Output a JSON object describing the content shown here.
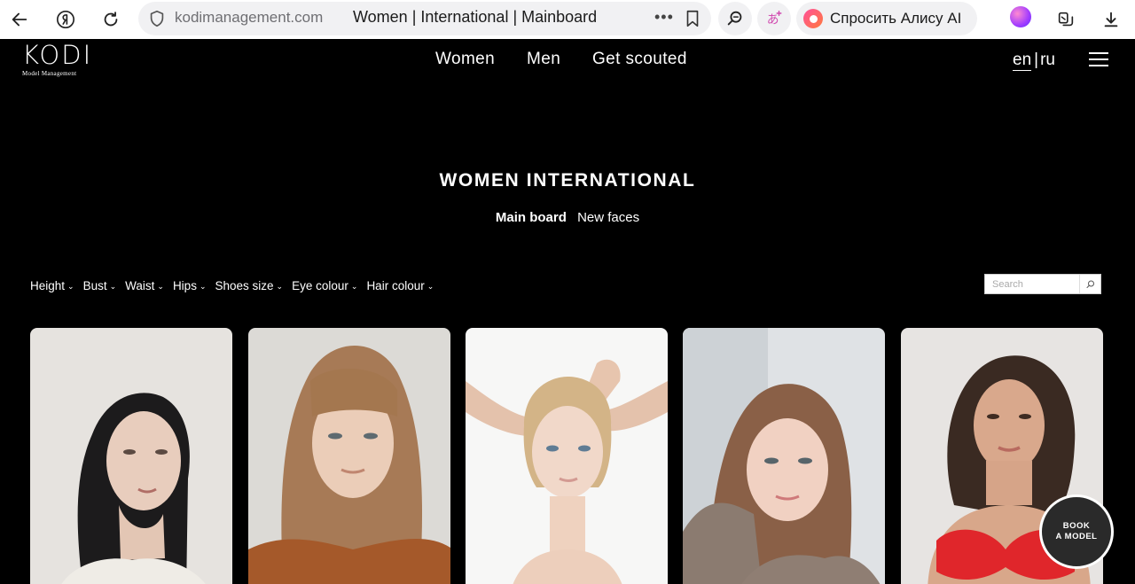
{
  "browser": {
    "domain": "kodimanagement.com",
    "page_title": "Women | International | Mainboard",
    "more_label": "•••",
    "alice_label": "Спросить Алису AI",
    "icons": [
      "back-arrow-icon",
      "yandex-icon",
      "reload-icon",
      "shield-icon",
      "bookmark-icon",
      "lens-search-icon",
      "translate-icon",
      "alice-icon",
      "profile-icon",
      "collections-icon",
      "download-icon"
    ]
  },
  "site": {
    "logo_text": "KODI",
    "logo_subtext": "Model Management",
    "nav": [
      {
        "label": "Women"
      },
      {
        "label": "Men"
      },
      {
        "label": "Get scouted"
      }
    ],
    "lang": {
      "en": "en",
      "separator": "|",
      "ru": "ru"
    }
  },
  "page": {
    "title": "WOMEN INTERNATIONAL",
    "tabs": [
      {
        "label": "Main board",
        "active": true
      },
      {
        "label": "New faces",
        "active": false
      }
    ]
  },
  "filters": [
    {
      "label": "Height"
    },
    {
      "label": "Bust"
    },
    {
      "label": "Waist"
    },
    {
      "label": "Hips"
    },
    {
      "label": "Shoes size"
    },
    {
      "label": "Eye colour"
    },
    {
      "label": "Hair colour"
    }
  ],
  "search": {
    "placeholder": "Search"
  },
  "models": [
    {
      "photo": "model-photo-dark-hair"
    },
    {
      "photo": "model-photo-fringe"
    },
    {
      "photo": "model-photo-arms-up"
    },
    {
      "photo": "model-photo-sweater"
    },
    {
      "photo": "model-photo-red-top"
    }
  ],
  "book_button": {
    "line1": "BOOK",
    "line2": "A MODEL"
  },
  "colors": {
    "background": "#000000",
    "text": "#ffffff",
    "alice_accent": "#ff4f9a"
  }
}
